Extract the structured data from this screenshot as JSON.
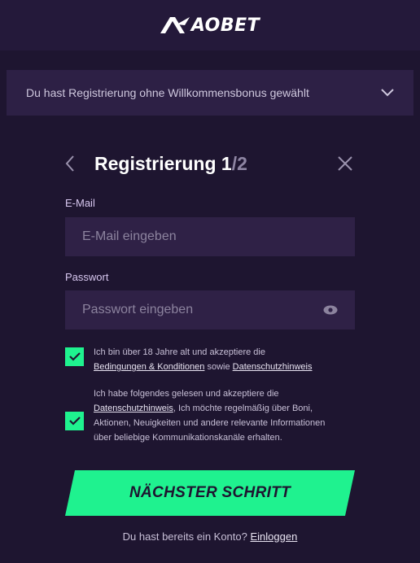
{
  "header": {
    "logo_text": "AOBET",
    "logo_icon": "brand-mark-icon"
  },
  "bonus_bar": {
    "text": "Du hast Registrierung ohne Willkommensbonus gewählt",
    "icon": "chevron-down-icon"
  },
  "form": {
    "title": "Registrierung",
    "step_current": "1",
    "step_total": "/2",
    "back_icon": "chevron-left-icon",
    "close_icon": "close-icon",
    "email": {
      "label": "E-Mail",
      "value": "",
      "placeholder": "E-Mail eingeben"
    },
    "password": {
      "label": "Passwort",
      "value": "",
      "placeholder": "Passwort eingeben",
      "icon": "eye-icon"
    },
    "consent_terms": {
      "checked": true,
      "text_before": "Ich bin über 18 Jahre alt und akzeptiere die",
      "link_terms": "Bedingungen & Konditionen",
      "text_middle": "sowie",
      "link_privacy": "Datenschutzhinweis"
    },
    "consent_marketing": {
      "checked": true,
      "text_before": "Ich habe folgendes gelesen und akzeptiere die",
      "link_privacy": "Datenschutzhinweis",
      "text_after": ", Ich möchte regelmäßig über Boni, Aktionen, Neuigkeiten und andere relevante Informationen über beliebige Kommunikationskanäle erhalten."
    },
    "next_button": "NÄCHSTER SCHRITT",
    "login_prompt": "Du hast bereits ein Konto?",
    "login_link": "Einloggen"
  },
  "colors": {
    "background": "#1e1530",
    "panel": "#2f2146",
    "accent": "#1ff28f",
    "header": "#24193a"
  }
}
